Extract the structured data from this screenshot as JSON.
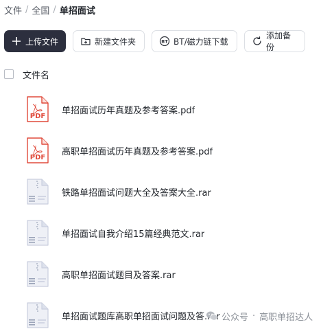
{
  "breadcrumb": {
    "items": [
      "文件",
      "全国",
      "单招面试"
    ],
    "separator": "/"
  },
  "toolbar": {
    "upload_label": "上传文件",
    "new_folder_label": "新建文件夹",
    "bt_label": "BT/磁力链下载",
    "backup_label": "添加备份"
  },
  "list": {
    "header_label": "文件名",
    "files": [
      {
        "name": "单招面试历年真题及参考答案.pdf",
        "type": "pdf",
        "icon": "pdf-file-icon"
      },
      {
        "name": "高职单招面试历年真题及参考答案.pdf",
        "type": "pdf",
        "icon": "pdf-file-icon"
      },
      {
        "name": "铁路单招面试问题大全及答案大全.rar",
        "type": "rar",
        "icon": "archive-file-icon"
      },
      {
        "name": "单招面试自我介绍15篇经典范文.rar",
        "type": "rar",
        "icon": "archive-file-icon"
      },
      {
        "name": "高职单招面试题目及答案.rar",
        "type": "rar",
        "icon": "archive-file-icon"
      },
      {
        "name": "单招面试题库高职单招面试问题及答.rar",
        "type": "rar",
        "icon": "archive-file-icon"
      }
    ]
  },
  "watermark": {
    "prefix": "公众号",
    "dot": "·",
    "name": "高职单招达人"
  },
  "colors": {
    "primary_button": "#2c2f3e",
    "pdf_red": "#e04a3b",
    "archive_gray": "#9aa3b8"
  }
}
